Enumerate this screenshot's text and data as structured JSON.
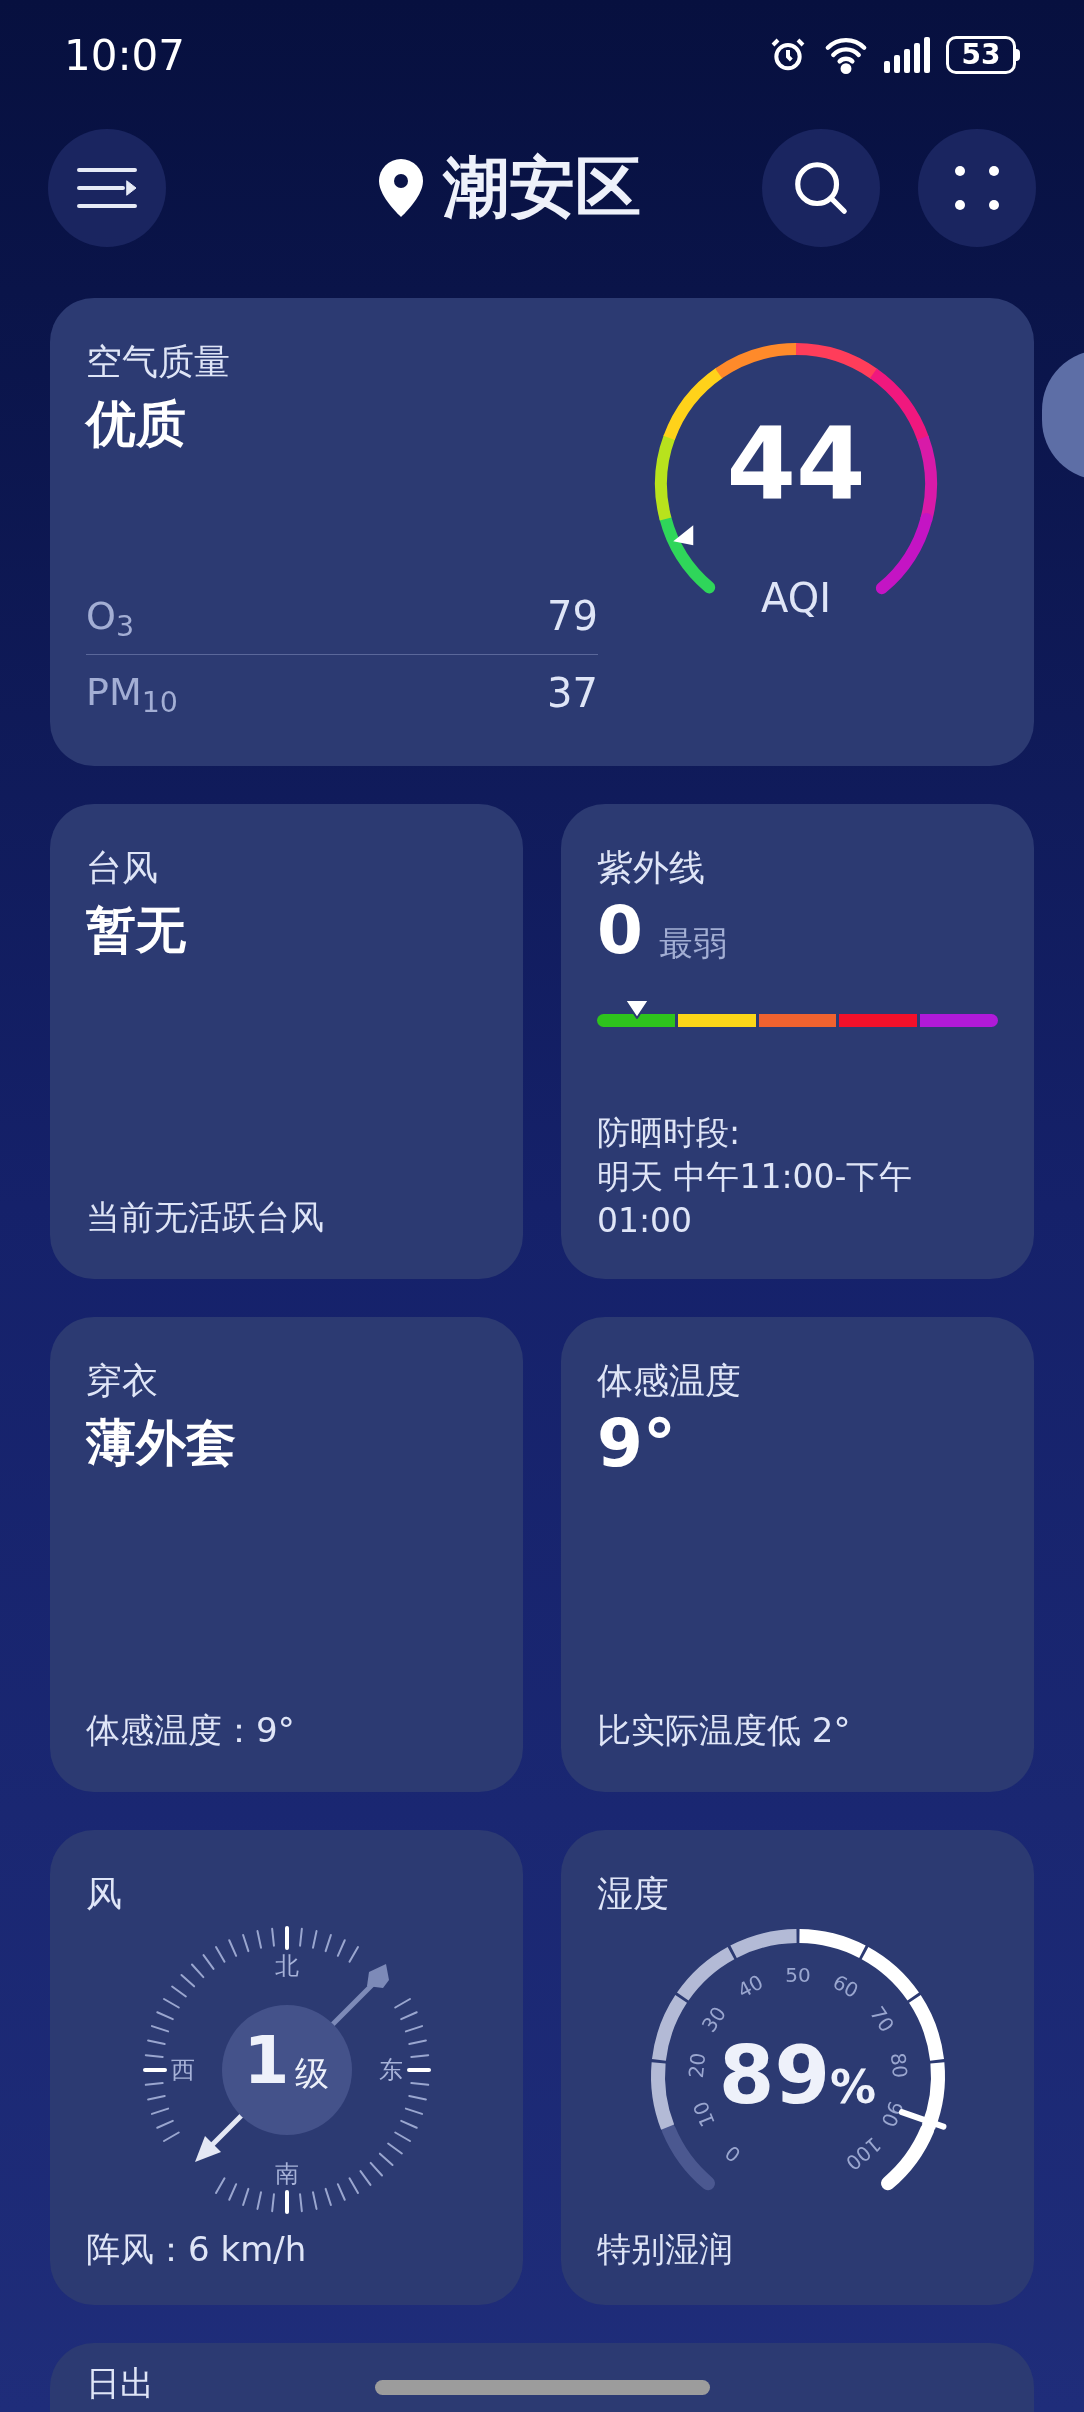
{
  "status_bar": {
    "time": "10:07",
    "battery": "53"
  },
  "header": {
    "location": "潮安区"
  },
  "air_quality": {
    "title": "空气质量",
    "status": "优质",
    "pollutants": [
      {
        "name": "O$_{3}$",
        "value": "79"
      },
      {
        "name": "PM$_{10}$",
        "value": "37"
      }
    ],
    "aqi": "44",
    "aqi_label": "AQI"
  },
  "typhoon": {
    "title": "台风",
    "value": "暂无",
    "note": "当前无活跃台风"
  },
  "uv": {
    "title": "紫外线",
    "value": "0",
    "rating": "最弱",
    "bands": [
      {
        "color": "#2ec31c"
      },
      {
        "color": "#fcd618"
      },
      {
        "color": "#f0622f"
      },
      {
        "color": "#f2102a"
      },
      {
        "color": "#b01ad8"
      }
    ],
    "period_label": "防晒时段:",
    "period": "明天 中午11:00-下午01:00"
  },
  "clothing": {
    "title": "穿衣",
    "value": "薄外套",
    "note": "体感温度：9°"
  },
  "feels_like": {
    "title": "体感温度",
    "value": "9°",
    "note": "比实际温度低 2°"
  },
  "wind": {
    "title": "风",
    "north": "北",
    "east": "东",
    "south": "南",
    "west": "西",
    "force": "1",
    "force_unit": "级",
    "gust": "阵风：6 km/h"
  },
  "humidity": {
    "title": "湿度",
    "value": "89",
    "unit": "%",
    "scale": [
      "0",
      "10",
      "20",
      "30",
      "40",
      "50",
      "60",
      "70",
      "80",
      "90",
      "100"
    ],
    "note": "特别湿润"
  },
  "sunrise": {
    "title": "日出"
  }
}
